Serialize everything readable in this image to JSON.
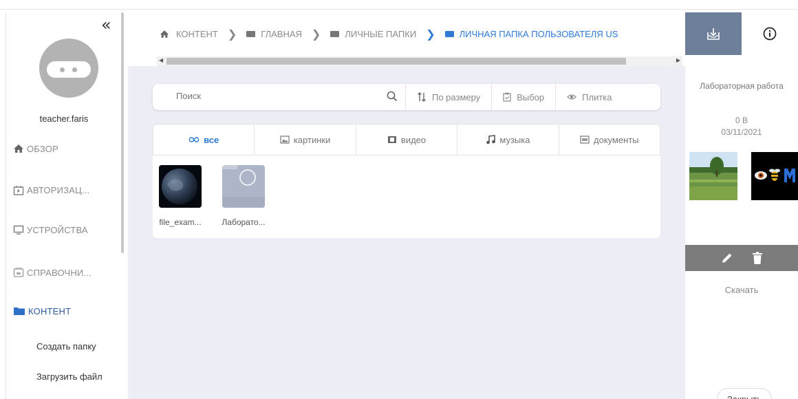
{
  "sidebar": {
    "collapse_glyph": "«",
    "username": "teacher.faris",
    "nav": [
      {
        "label": "ОБЗОР",
        "icon": "home-icon"
      },
      {
        "label": "АВТОРИЗАЦ...",
        "icon": "login-icon"
      },
      {
        "label": "УСТРОЙСТВА",
        "icon": "monitor-icon"
      },
      {
        "label": "СПРАВОЧНИ...",
        "icon": "directory-icon"
      },
      {
        "label": "КОНТЕНТ",
        "icon": "folder-icon",
        "active": true
      }
    ],
    "sub_items": [
      "Создать папку",
      "Загрузить файл"
    ]
  },
  "breadcrumb": [
    {
      "label": "КОНТЕНТ",
      "icon": "home-icon"
    },
    {
      "label": "ГЛАВНАЯ",
      "icon": "folder-icon"
    },
    {
      "label": "ЛИЧНЫЕ ПАПКИ",
      "icon": "folder-icon"
    },
    {
      "label": "ЛИЧНАЯ ПАПКА ПОЛЬЗОВАТЕЛЯ US",
      "icon": "folder-icon",
      "active": true
    }
  ],
  "toolbar": {
    "search_placeholder": "Поиск",
    "sort_label": "По размеру",
    "select_label": "Выбор",
    "view_label": "Плитка"
  },
  "filters": [
    {
      "label": "все",
      "icon": "infinity-icon",
      "active": true
    },
    {
      "label": "картинки",
      "icon": "image-icon"
    },
    {
      "label": "видео",
      "icon": "video-icon"
    },
    {
      "label": "музыка",
      "icon": "music-icon"
    },
    {
      "label": "документы",
      "icon": "document-icon"
    }
  ],
  "files": [
    {
      "name": "file_exam...",
      "type": "image"
    },
    {
      "name": "Лаборато...",
      "type": "folder"
    }
  ],
  "panel": {
    "title": "Лабораторная работа",
    "size": "0 B",
    "date": "03/11/2021",
    "download_label": "Скачать",
    "close_label": "Закрыть"
  },
  "colors": {
    "accent": "#2f7bd6",
    "nav_active": "#2e5aa0",
    "panel_tab": "#6e7f99",
    "action_bar": "#7b7b7b",
    "main_bg": "#ecedf5"
  }
}
